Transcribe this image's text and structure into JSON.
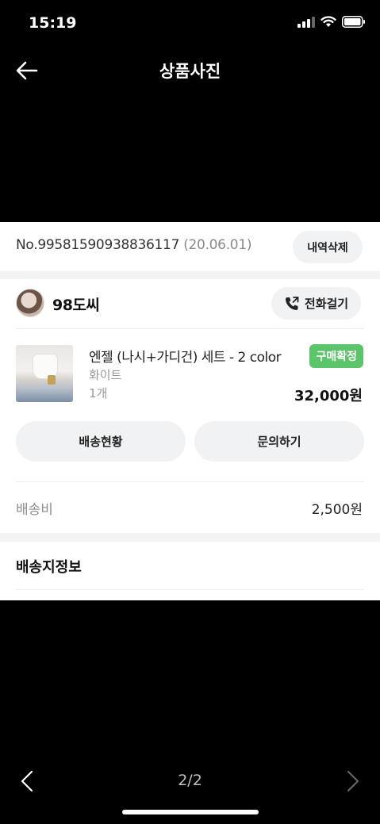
{
  "status_bar": {
    "time": "15:19"
  },
  "nav": {
    "title": "상품사진"
  },
  "order": {
    "number": "No.99581590938836117",
    "date": "(20.06.01)",
    "delete_label": "내역삭제"
  },
  "seller": {
    "name": "98도씨",
    "call_label": "전화걸기"
  },
  "product": {
    "name": "엔젤 (나시+가디건) 세트 - 2 color",
    "option": "화이트",
    "quantity": "1개",
    "status_badge": "구매확정",
    "price": "32,000원"
  },
  "actions": {
    "shipping_status_label": "배송현황",
    "inquiry_label": "문의하기"
  },
  "shipping_fee": {
    "label": "배송비",
    "value": "2,500원"
  },
  "shipping_info": {
    "title": "배송지정보"
  },
  "pager": {
    "indicator": "2/2"
  },
  "colors": {
    "badge_green": "#5cc46a",
    "background": "#000000",
    "button_gray": "#f1f2f4"
  }
}
